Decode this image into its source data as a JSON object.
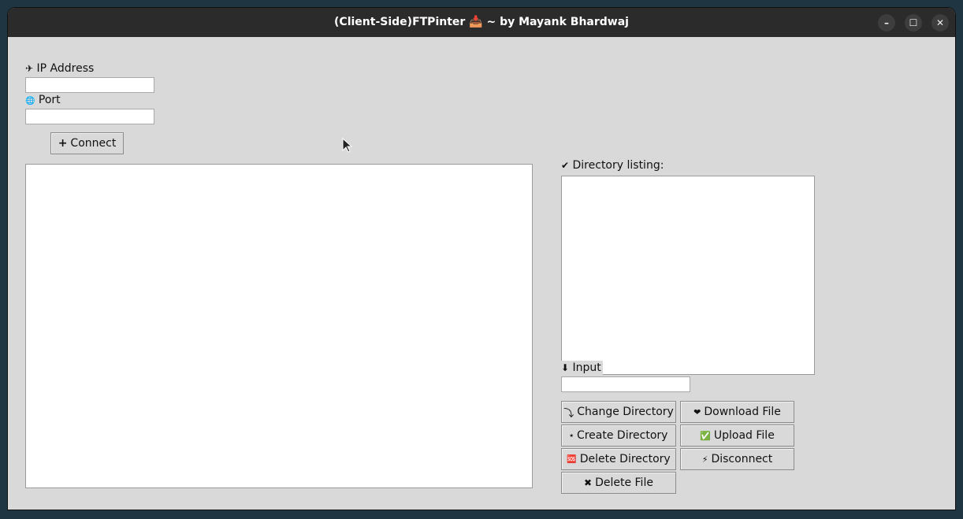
{
  "window": {
    "title": "(Client-Side)FTPinter 📥 ~ by Mayank Bhardwaj",
    "minimize_glyph": "–",
    "maximize_glyph": "☐",
    "close_glyph": "✕"
  },
  "connection": {
    "ip_icon": "✈",
    "ip_label": "IP Address",
    "ip_value": "",
    "port_icon": "🌐",
    "port_label": "Port",
    "port_value": "",
    "connect_icon": "+",
    "connect_label": "Connect"
  },
  "directory": {
    "listing_icon": "✔",
    "listing_label": "Directory listing:",
    "input_icon": "⬇",
    "input_label": "Input",
    "input_value": ""
  },
  "actions": {
    "change_dir_icon": "⤵",
    "change_dir_label": "Change Directory",
    "download_icon": "❤",
    "download_label": "Download File",
    "create_dir_icon": "⭑",
    "create_dir_label": "Create Directory",
    "upload_icon": "✅",
    "upload_label": "Upload File",
    "delete_dir_icon": "🆘",
    "delete_dir_label": "Delete Directory",
    "disconnect_icon": "⚡",
    "disconnect_label": "Disconnect",
    "delete_file_icon": "✖",
    "delete_file_label": "Delete File"
  }
}
